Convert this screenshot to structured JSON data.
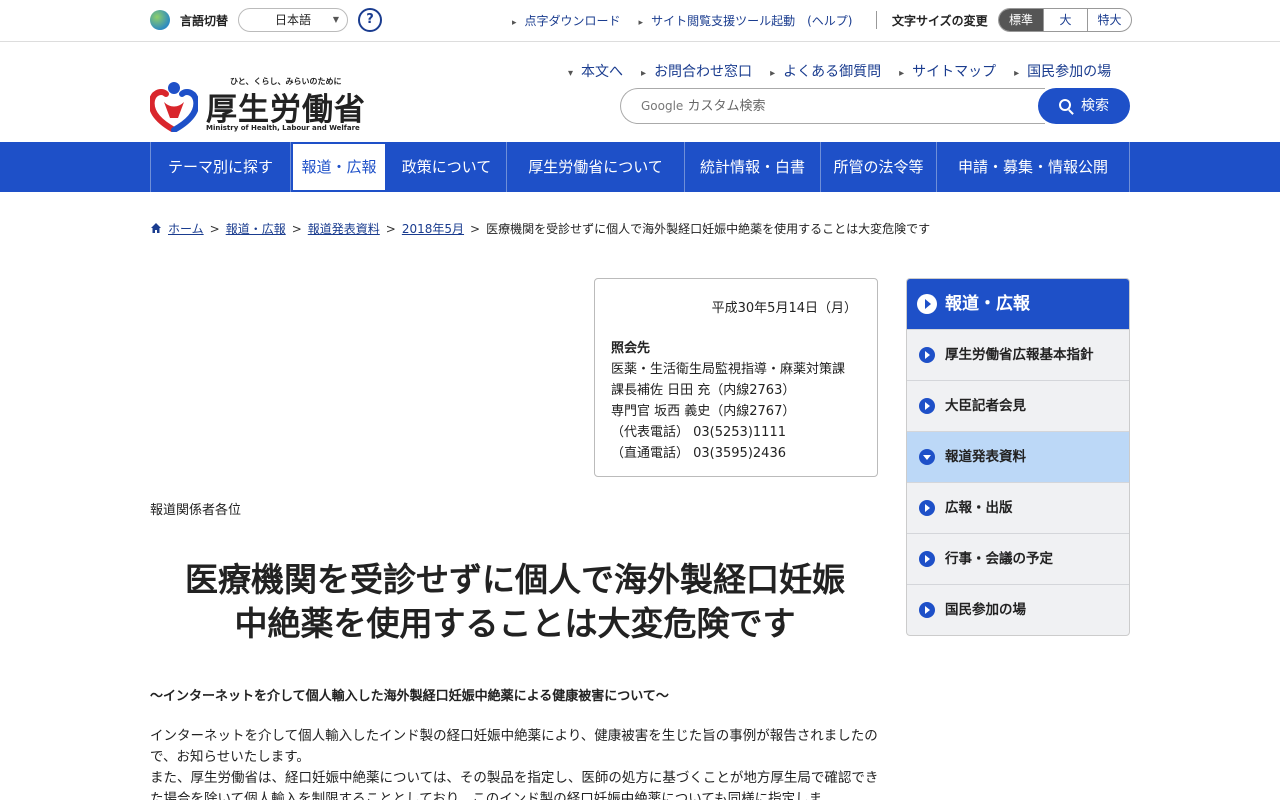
{
  "topbar": {
    "lang_label": "言語切替",
    "lang_value": "日本語",
    "help_label": "?",
    "links": [
      "点字ダウンロード",
      "サイト閲覧支援ツール起動　(ヘルプ)"
    ],
    "fontsize_label": "文字サイズの変更",
    "fontsize_options": [
      "標準",
      "大",
      "特大"
    ]
  },
  "header": {
    "logo_tagline": "ひと、くらし、みらいのために",
    "logo_name": "厚生労働省",
    "logo_en": "Ministry of Health, Labour and Welfare",
    "links": [
      "本文へ",
      "お問合わせ窓口",
      "よくある御質問",
      "サイトマップ",
      "国民参加の場"
    ],
    "search_brand": "Google",
    "search_placeholder": "カスタム検索",
    "search_button": "検索"
  },
  "gnav": [
    "テーマ別に探す",
    "報道・広報",
    "政策について",
    "厚生労働省について",
    "統計情報・白書",
    "所管の法令等",
    "申請・募集・情報公開"
  ],
  "breadcrumb": {
    "items": [
      "ホーム",
      "報道・広報",
      "報道発表資料",
      "2018年5月"
    ],
    "current": "医療機関を受診せずに個人で海外製経口妊娠中絶薬を使用することは大変危険です"
  },
  "contact": {
    "date": "平成30年5月14日（月）",
    "heading": "照会先",
    "lines": [
      "医薬・生活衛生局監視指導・麻薬対策課",
      "課長補佐 日田 充（内線2763）",
      "専門官 坂西 義史（内線2767）",
      "（代表電話） 03(5253)1111",
      "（直通電話） 03(3595)2436"
    ]
  },
  "article": {
    "recipients": "報道関係者各位",
    "title_line1": "医療機関を受診せずに個人で海外製経口妊娠",
    "title_line2": "中絶薬を使用することは大変危険です",
    "subtitle": "～インターネットを介して個人輸入した海外製経口妊娠中絶薬による健康被害について～",
    "para1": "インターネットを介して個人輸入したインド製の経口妊娠中絶薬により、健康被害を生じた旨の事例が報告されましたので、お知らせいたします。",
    "para2": "また、厚生労働省は、経口妊娠中絶薬については、その製品を指定し、医師の処方に基づくことが地方厚生局で確認できた場合を除いて個人輸入を制限することとしており、このインド製の経口妊娠中絶薬についても同様に指定しま"
  },
  "side": {
    "heading": "報道・広報",
    "items": [
      "厚生労働省広報基本指針",
      "大臣記者会見",
      "報道発表資料",
      "広報・出版",
      "行事・会議の予定",
      "国民参加の場"
    ]
  },
  "colors": {
    "brand_blue": "#1e50c8",
    "current_item": "#bcd8f7"
  }
}
